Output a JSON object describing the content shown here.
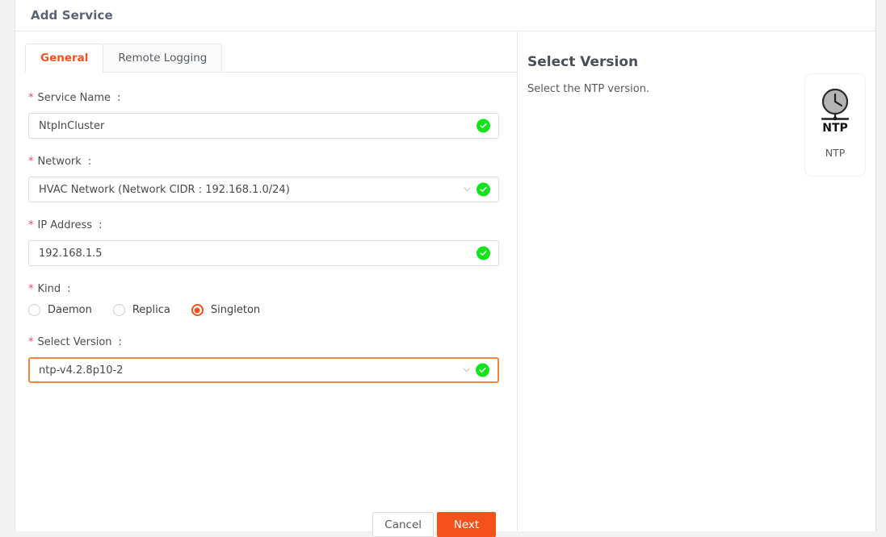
{
  "window": {
    "title": "Add Service"
  },
  "tabs": [
    {
      "label": "General",
      "active": true
    },
    {
      "label": "Remote Logging",
      "active": false
    }
  ],
  "form": {
    "required_marker": "*",
    "colon": ":",
    "fields": [
      {
        "label": "Service Name",
        "type": "text",
        "value": "NtpInCluster",
        "placeholder": "",
        "valid": true,
        "focused": false
      },
      {
        "label": "Network",
        "type": "select",
        "value": "HVAC Network (Network CIDR : 192.168.1.0/24)",
        "placeholder": "",
        "valid": true,
        "focused": false
      },
      {
        "label": "IP Address",
        "type": "text",
        "value": "192.168.1.5",
        "placeholder": "",
        "valid": true,
        "focused": false
      },
      {
        "label": "Select Version",
        "type": "select",
        "value": "ntp-v4.2.8p10-2",
        "placeholder": "",
        "valid": true,
        "focused": true
      }
    ],
    "kind": {
      "label": "Kind",
      "options": [
        {
          "label": "Daemon",
          "selected": false
        },
        {
          "label": "Replica",
          "selected": false
        },
        {
          "label": "Singleton",
          "selected": true
        }
      ]
    }
  },
  "actions": {
    "cancel_label": "Cancel",
    "next_label": "Next"
  },
  "info_panel": {
    "title": "Select Version",
    "description": "Select the NTP version.",
    "service_card": {
      "icon": "ntp-clock-icon",
      "icon_text": "NTP",
      "label": "NTP"
    }
  },
  "colors": {
    "accent": "#f4521a",
    "focus_border": "#f4843c",
    "required": "#f2466c",
    "valid": "#12e41c",
    "title": "#5b6275",
    "border": "#e6e6e6"
  }
}
